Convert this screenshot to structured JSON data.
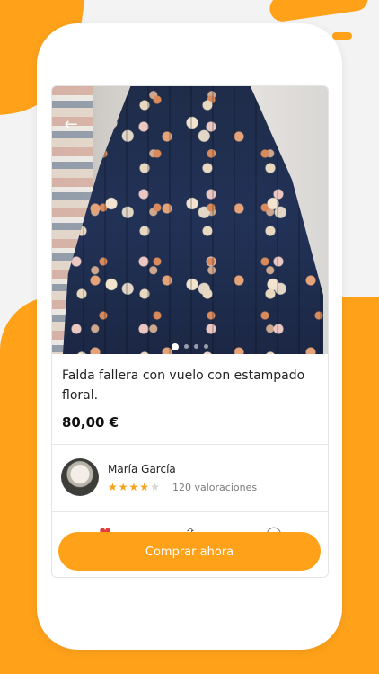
{
  "product": {
    "title": "Falda fallera con vuelo con estampado floral.",
    "price": "80,00 €",
    "image_count": 4,
    "active_image": 0
  },
  "seller": {
    "name": "María García",
    "rating": 4,
    "rating_max": 5,
    "reviews_label": "120 valoraciones"
  },
  "actions": {
    "buy_label": "Comprar ahora",
    "icons": [
      "heart-icon",
      "share-icon",
      "chat-icon"
    ]
  },
  "colors": {
    "accent": "#ffa21a",
    "heart": "#e53b3b",
    "star": "#f7a21b"
  }
}
